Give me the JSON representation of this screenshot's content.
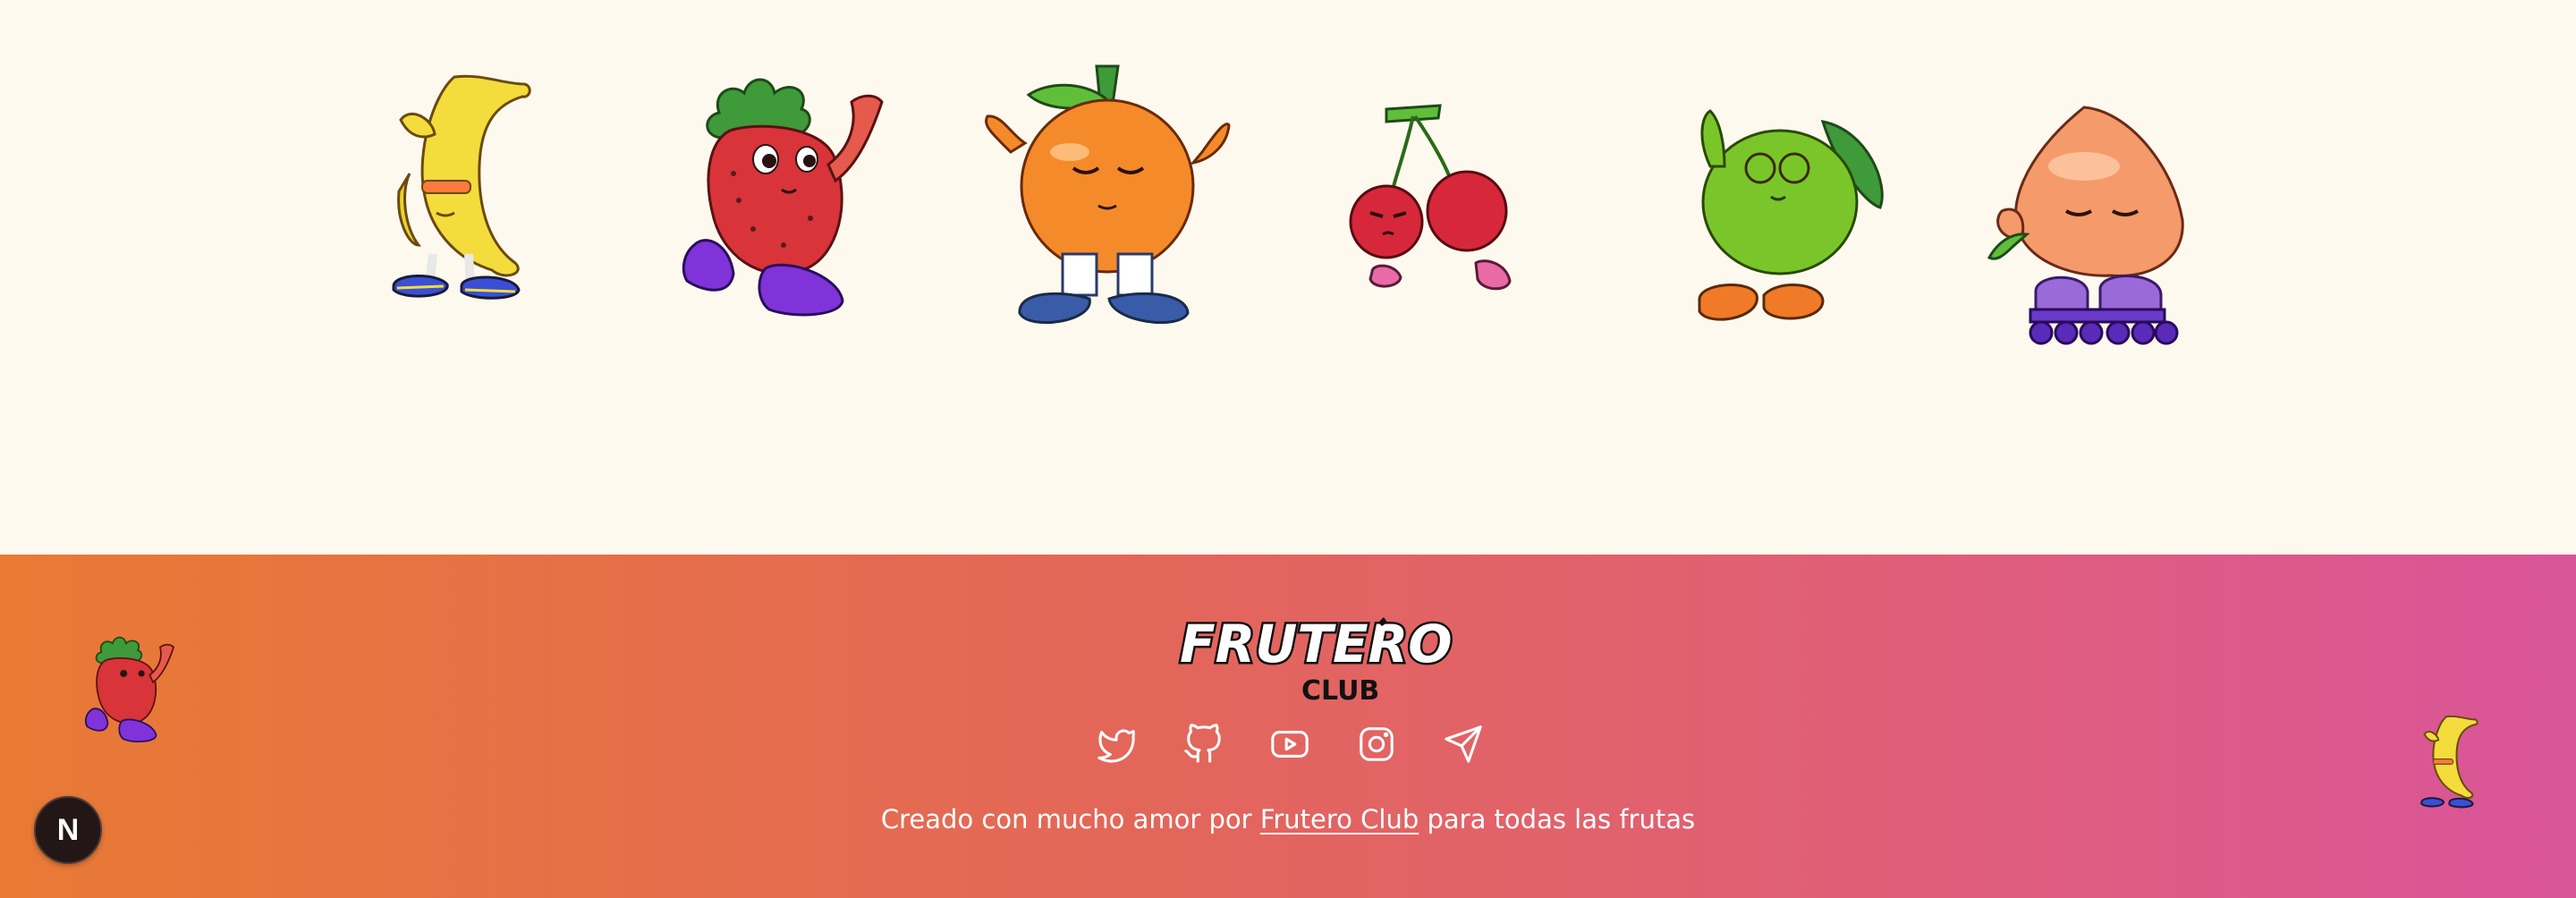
{
  "fruits": [
    {
      "name": "banana-character"
    },
    {
      "name": "strawberry-character"
    },
    {
      "name": "orange-character"
    },
    {
      "name": "cherry-character"
    },
    {
      "name": "lime-character"
    },
    {
      "name": "peach-character"
    }
  ],
  "footer": {
    "logo_text": "FRUTERO",
    "logo_subtext": "CLUB",
    "socials": [
      {
        "icon": "twitter-icon"
      },
      {
        "icon": "github-icon"
      },
      {
        "icon": "youtube-icon"
      },
      {
        "icon": "instagram-icon"
      },
      {
        "icon": "telegram-icon"
      }
    ],
    "credit_prefix": "Creado con mucho amor por ",
    "credit_link": "Frutero Club",
    "credit_suffix": " para todas las frutas"
  },
  "badge": {
    "label": "N"
  },
  "colors": {
    "page_bg": "#fef9ee",
    "gradient_start": "#e97a35",
    "gradient_end": "#d9559a",
    "text": "#ffffff"
  }
}
